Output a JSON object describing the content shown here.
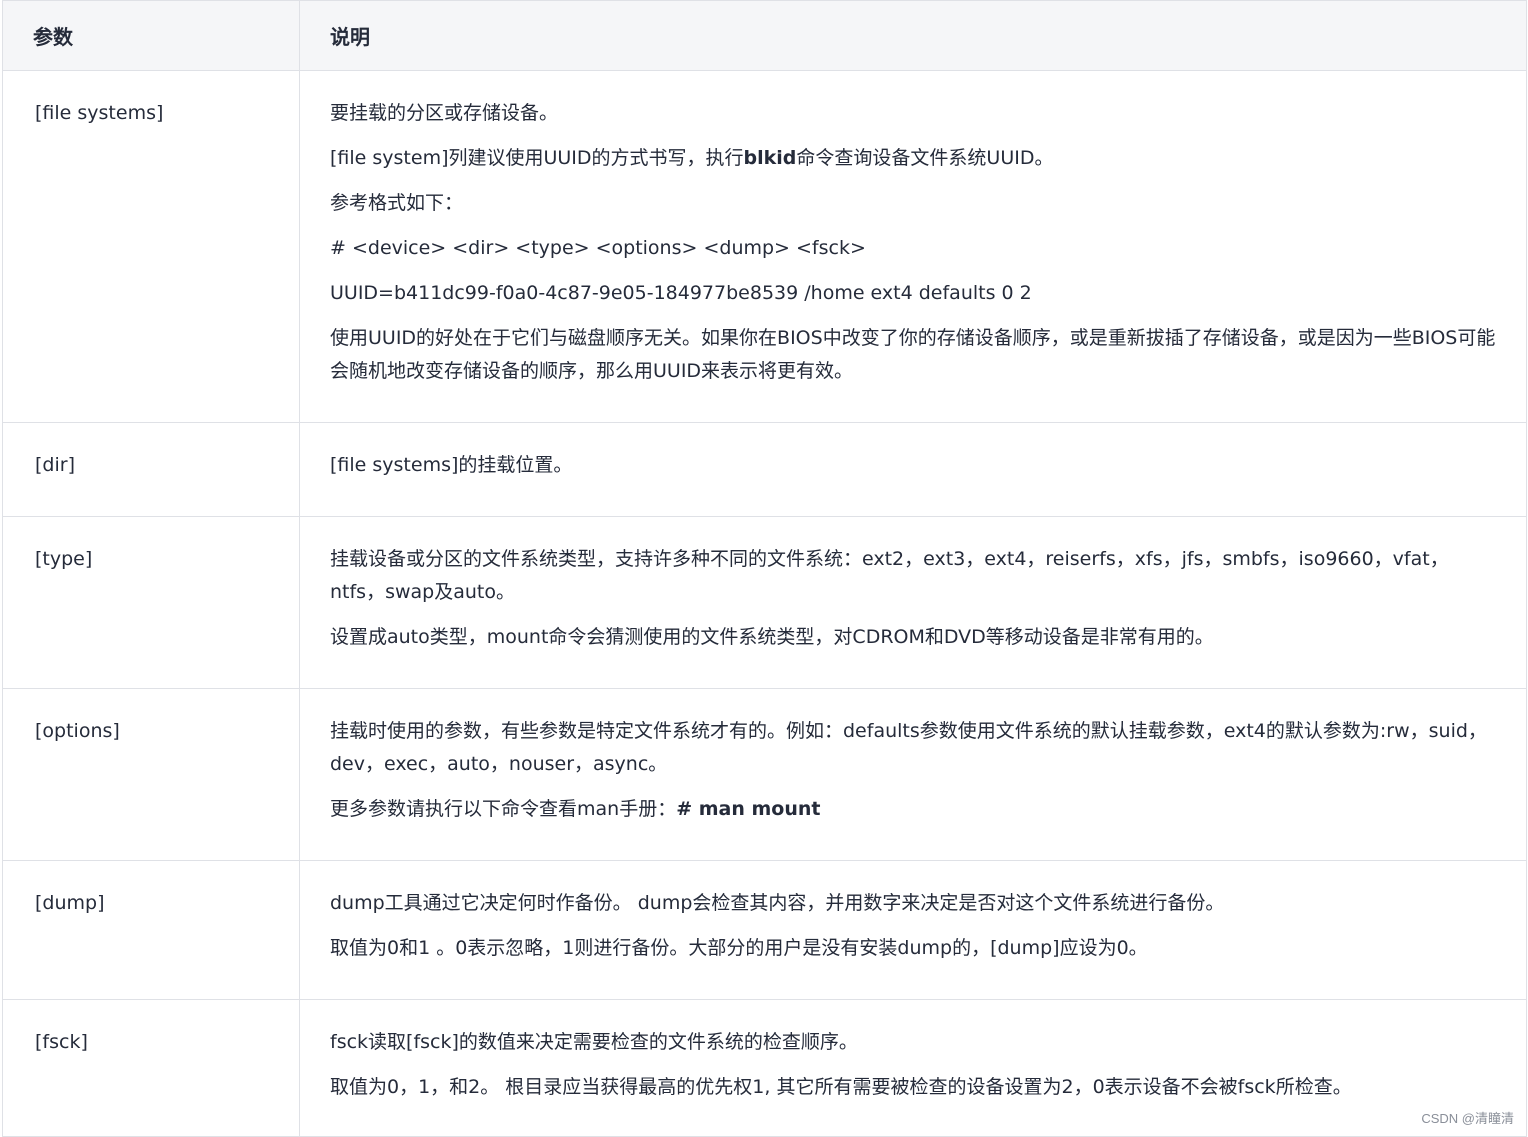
{
  "table": {
    "headers": [
      "参数",
      "说明"
    ],
    "rows": [
      {
        "param": "[file systems]",
        "desc": [
          [
            {
              "t": "要挂载的分区或存储设备。"
            }
          ],
          [
            {
              "t": "[file system]列建议使用UUID的方式书写，执行"
            },
            {
              "t": "blkid",
              "b": true
            },
            {
              "t": "命令查询设备文件系统UUID。"
            }
          ],
          [
            {
              "t": "参考格式如下："
            }
          ],
          [
            {
              "t": "# <device> <dir> <type> <options> <dump> <fsck>"
            }
          ],
          [
            {
              "t": "UUID=b411dc99-f0a0-4c87-9e05-184977be8539 /home ext4 defaults 0 2"
            }
          ],
          [
            {
              "t": "使用UUID的好处在于它们与磁盘顺序无关。如果你在BIOS中改变了你的存储设备顺序，或是重新拔插了存储设备，或是因为一些BIOS可能会随机地改变存储设备的顺序，那么用UUID来表示将更有效。"
            }
          ]
        ]
      },
      {
        "param": "[dir]",
        "desc": [
          [
            {
              "t": "[file systems]的挂载位置。"
            }
          ]
        ]
      },
      {
        "param": "[type]",
        "desc": [
          [
            {
              "t": "挂载设备或分区的文件系统类型，支持许多种不同的文件系统：ext2，ext3，ext4，reiserfs，xfs，jfs，smbfs，iso9660，vfat，ntfs，swap及auto。"
            }
          ],
          [
            {
              "t": "设置成auto类型，mount命令会猜测使用的文件系统类型，对CDROM和DVD等移动设备是非常有用的。"
            }
          ]
        ]
      },
      {
        "param": "[options]",
        "desc": [
          [
            {
              "t": "挂载时使用的参数，有些参数是特定文件系统才有的。例如：defaults参数使用文件系统的默认挂载参数，ext4的默认参数为:rw，suid，dev，exec，auto，nouser，async。"
            }
          ],
          [
            {
              "t": "更多参数请执行以下命令查看man手册："
            },
            {
              "t": "# man mount",
              "b": true
            }
          ]
        ]
      },
      {
        "param": "[dump]",
        "desc": [
          [
            {
              "t": "dump工具通过它决定何时作备份。 dump会检查其内容，并用数字来决定是否对这个文件系统进行备份。"
            }
          ],
          [
            {
              "t": "取值为0和1 。0表示忽略，1则进行备份。大部分的用户是没有安装dump的，[dump]应设为0。"
            }
          ]
        ]
      },
      {
        "param": "[fsck]",
        "desc": [
          [
            {
              "t": "fsck读取[fsck]的数值来决定需要检查的文件系统的检查顺序。"
            }
          ],
          [
            {
              "t": "取值为0，1，和2。 根目录应当获得最高的优先权1, 其它所有需要被检查的设备设置为2，0表示设备不会被fsck所检查。"
            }
          ]
        ]
      }
    ]
  },
  "watermark": "CSDN @清瞳清"
}
